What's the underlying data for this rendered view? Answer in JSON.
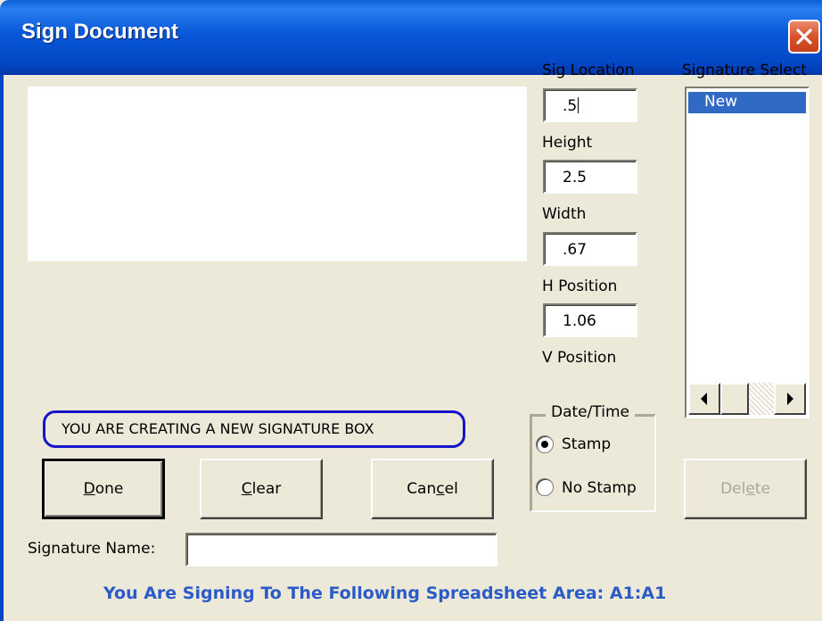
{
  "window": {
    "title": "Sign Document"
  },
  "fields": {
    "sig_location": {
      "label": "Sig Location",
      "value": ".5"
    },
    "height": {
      "label": "Height",
      "value": "2.5"
    },
    "width": {
      "label": "Width",
      "value": ".67"
    },
    "h_position": {
      "label": "H Position",
      "value": "1.06"
    },
    "v_position": {
      "label": "V Position"
    }
  },
  "signature_select": {
    "label": "Signature Select",
    "items": [
      "New"
    ],
    "selected": "New"
  },
  "notice": "YOU ARE CREATING A NEW SIGNATURE BOX",
  "buttons": {
    "done": {
      "pre": "",
      "accel": "D",
      "post": "one"
    },
    "clear": {
      "pre": "",
      "accel": "C",
      "post": "lear"
    },
    "cancel": {
      "pre": "Can",
      "accel": "c",
      "post": "el"
    },
    "delete": {
      "pre": "Del",
      "accel": "e",
      "post": "te"
    }
  },
  "date_time": {
    "title": "Date/Time",
    "stamp": "Stamp",
    "no_stamp": "No Stamp",
    "selected": "Stamp"
  },
  "signature_name": {
    "label": "Signature Name:",
    "value": ""
  },
  "footer": "You Are Signing To The Following Spreadsheet Area: A1:A1",
  "colors": {
    "titlebar": "#0a58d8",
    "selection": "#316ac5",
    "footer_text": "#2a5bc8",
    "notice_border": "#1414c8"
  }
}
